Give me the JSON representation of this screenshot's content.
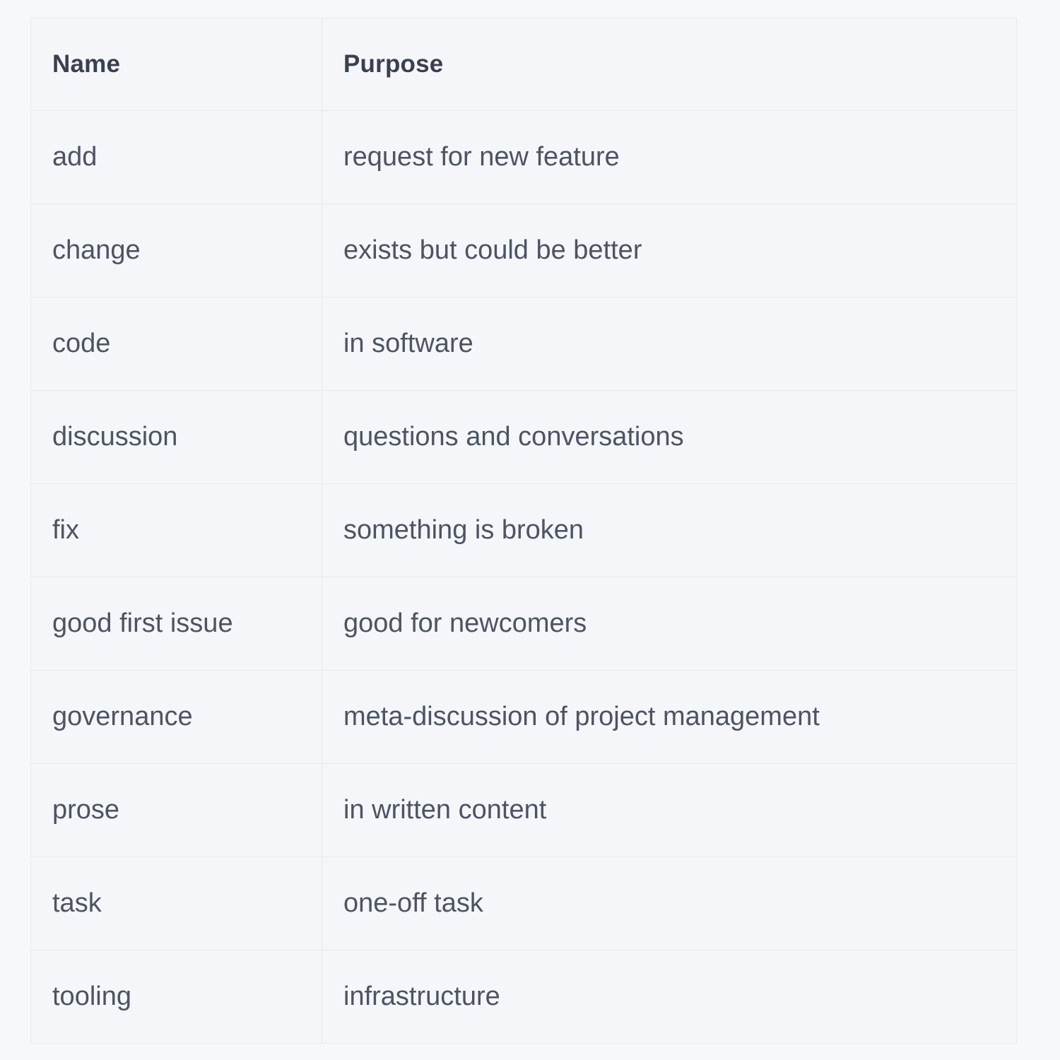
{
  "table": {
    "caption": "",
    "columns": [
      {
        "key": "name",
        "label": "Name"
      },
      {
        "key": "purpose",
        "label": "Purpose"
      }
    ],
    "rows": [
      {
        "name": "add",
        "purpose": "request for new feature"
      },
      {
        "name": "change",
        "purpose": "exists but could be better"
      },
      {
        "name": "code",
        "purpose": "in software"
      },
      {
        "name": "discussion",
        "purpose": "questions and conversations"
      },
      {
        "name": "fix",
        "purpose": "something is broken"
      },
      {
        "name": "good first issue",
        "purpose": "good for newcomers"
      },
      {
        "name": "governance",
        "purpose": "meta-discussion of project management"
      },
      {
        "name": "prose",
        "purpose": "in written content"
      },
      {
        "name": "task",
        "purpose": "one-off task"
      },
      {
        "name": "tooling",
        "purpose": "infrastructure"
      }
    ]
  },
  "colors": {
    "page_background": "#f7f8fa",
    "table_background": "#f5f6f9",
    "border": "#e7e9ee",
    "header_text": "#39404f",
    "body_text": "#4c5463"
  }
}
